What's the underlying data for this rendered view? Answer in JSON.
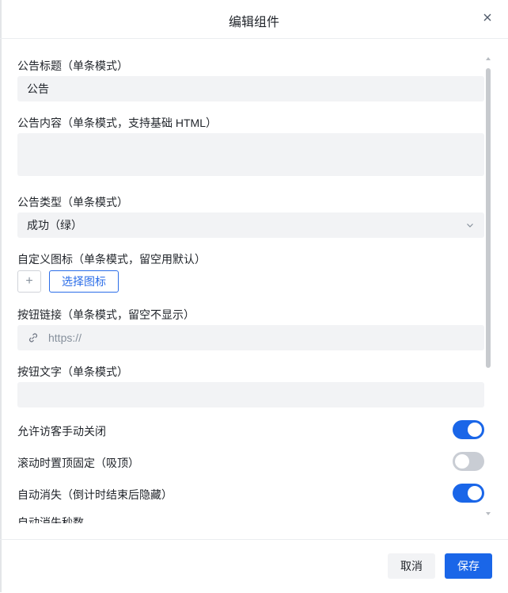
{
  "dialog": {
    "title": "编辑组件",
    "close_icon": "close-icon"
  },
  "fields": {
    "notice_title_label": "公告标题（单条模式）",
    "notice_title_value": "公告",
    "notice_content_label": "公告内容（单条模式，支持基础 HTML）",
    "notice_content_value": "",
    "notice_type_label": "公告类型（单条模式）",
    "notice_type_value": "成功（绿）",
    "custom_icon_label": "自定义图标（单条模式，留空用默认）",
    "upload_icon": "+",
    "choose_icon_button": "选择图标",
    "button_link_label": "按钮链接（单条模式，留空不显示）",
    "button_link_placeholder": "https://",
    "button_text_label": "按钮文字（单条模式）",
    "button_text_value": ""
  },
  "toggles": [
    {
      "label": "允许访客手动关闭",
      "on": true
    },
    {
      "label": "滚动时置顶固定（吸顶）",
      "on": false
    },
    {
      "label": "自动消失（倒计时结束后隐藏）",
      "on": true
    }
  ],
  "cutoff_label": "自动消失秒数",
  "footer": {
    "cancel": "取消",
    "save": "保存"
  },
  "colors": {
    "primary": "#1a66e8",
    "input_bg": "#f2f3f5",
    "toggle_off": "#c9cdd4"
  }
}
